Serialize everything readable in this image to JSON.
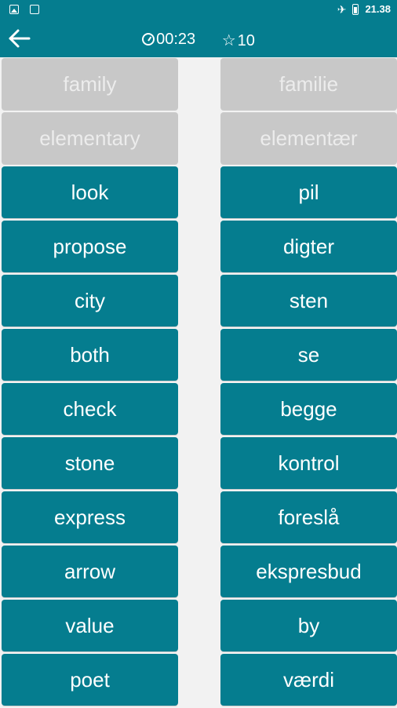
{
  "status": {
    "time": "21.38",
    "colors": {
      "accent": "#057d8f",
      "matched": "#c8c8c8"
    }
  },
  "header": {
    "timer": "00:23",
    "score": "10"
  },
  "left": [
    {
      "label": "family",
      "matched": true
    },
    {
      "label": "elementary",
      "matched": true
    },
    {
      "label": "look"
    },
    {
      "label": "propose"
    },
    {
      "label": "city"
    },
    {
      "label": "both"
    },
    {
      "label": "check"
    },
    {
      "label": "stone"
    },
    {
      "label": "express"
    },
    {
      "label": "arrow"
    },
    {
      "label": "value"
    },
    {
      "label": "poet"
    }
  ],
  "right": [
    {
      "label": "familie",
      "matched": true
    },
    {
      "label": "elementær",
      "matched": true
    },
    {
      "label": "pil"
    },
    {
      "label": "digter"
    },
    {
      "label": "sten"
    },
    {
      "label": "se"
    },
    {
      "label": "begge"
    },
    {
      "label": "kontrol"
    },
    {
      "label": "foreslå"
    },
    {
      "label": "ekspresbud"
    },
    {
      "label": "by"
    },
    {
      "label": "værdi"
    }
  ]
}
